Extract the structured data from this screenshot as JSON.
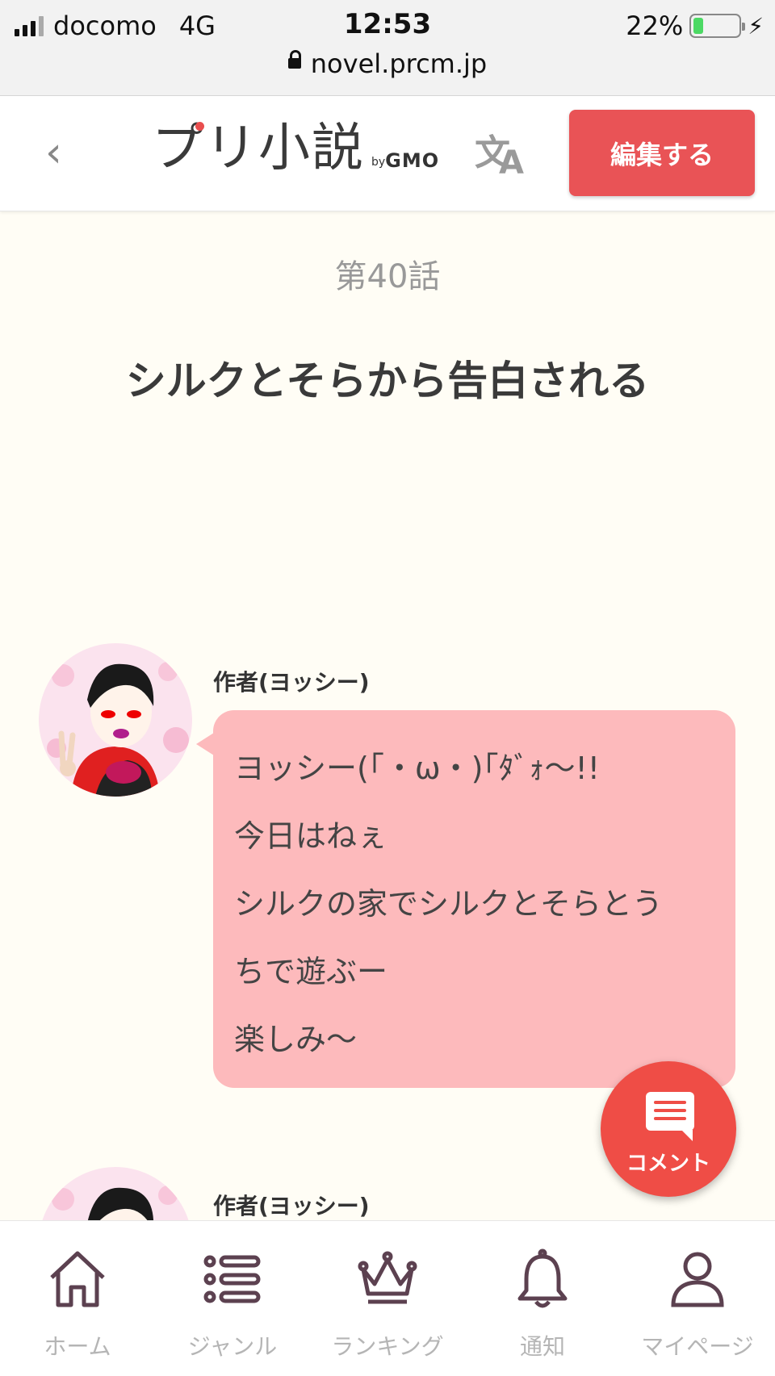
{
  "status_bar": {
    "carrier": "docomo",
    "network": "4G",
    "time": "12:53",
    "battery_percent": "22%",
    "battery_level": 0.22,
    "url": "novel.prcm.jp"
  },
  "header": {
    "logo": "プリ小説",
    "logo_by": "by",
    "logo_brand": "GMO",
    "edit_button": "編集する"
  },
  "chapter": {
    "episode": "第40話",
    "title": "シルクとそらから告白される"
  },
  "messages": [
    {
      "author": "作者(ヨッシー)",
      "lines": [
        "ヨッシー(｢・ω・)｢ﾀﾞｫ〜!!",
        "今日はねぇ",
        "シルクの家でシルクとそらとう",
        "ちで遊ぶー",
        "楽しみ〜"
      ]
    },
    {
      "author": "作者(ヨッシー)"
    }
  ],
  "fab": {
    "label": "コメント"
  },
  "bottom_nav": [
    {
      "label": "ホーム",
      "icon": "home-icon"
    },
    {
      "label": "ジャンル",
      "icon": "list-icon"
    },
    {
      "label": "ランキング",
      "icon": "crown-icon"
    },
    {
      "label": "通知",
      "icon": "bell-icon"
    },
    {
      "label": "マイページ",
      "icon": "person-icon"
    }
  ],
  "colors": {
    "accent": "#e95356",
    "bubble": "#fdbabc",
    "fab": "#ef4d46",
    "background": "#fffdf5"
  }
}
